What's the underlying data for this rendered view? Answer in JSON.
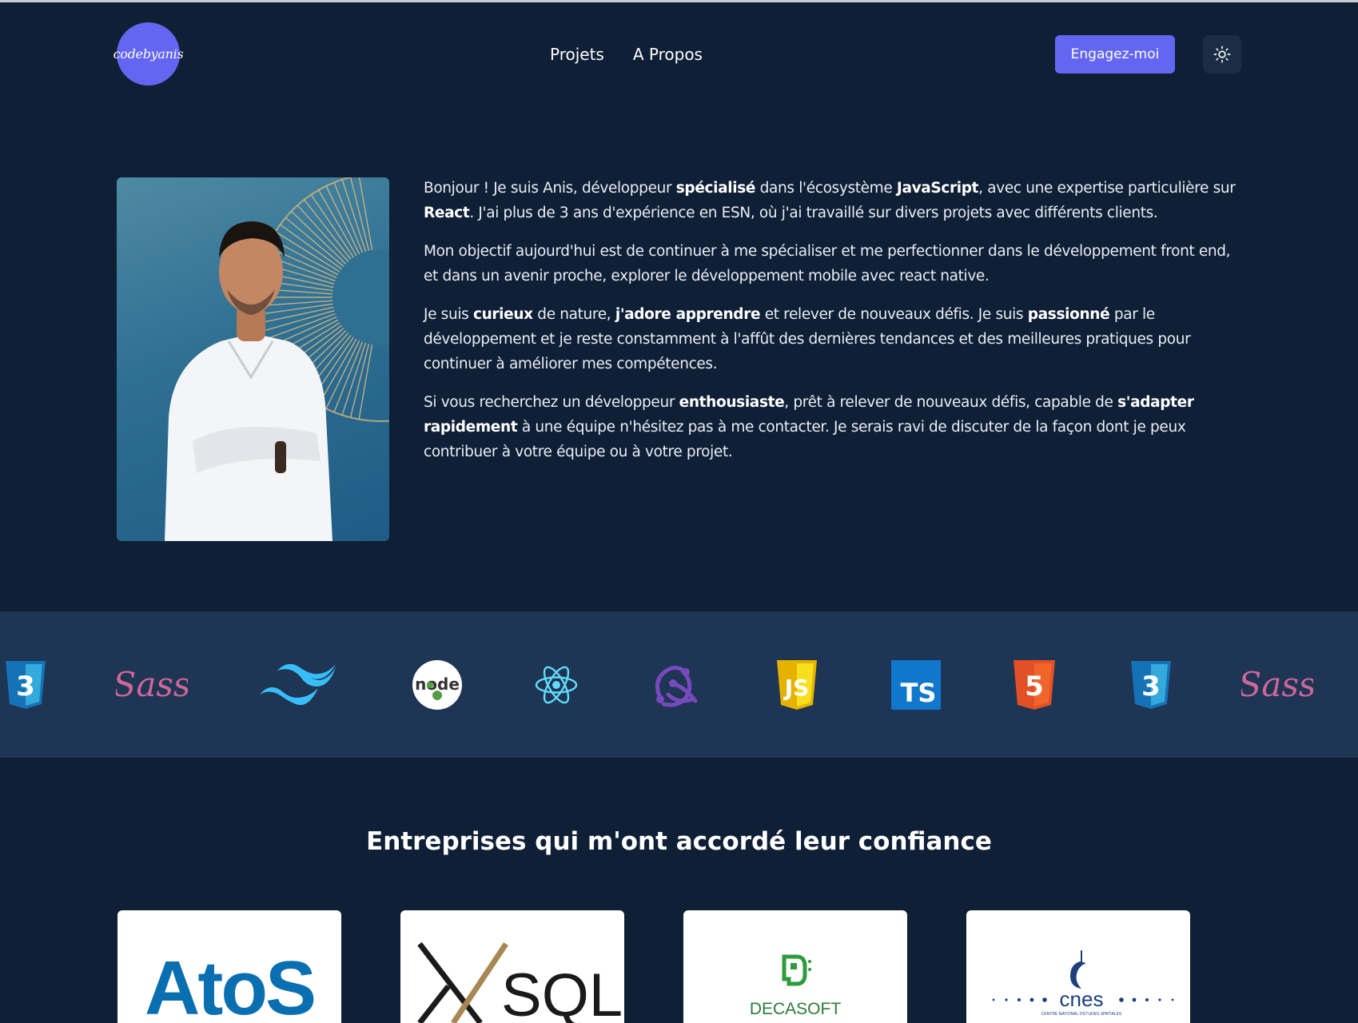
{
  "header": {
    "logo_text": "codebyanis",
    "nav": [
      {
        "label": "Projets"
      },
      {
        "label": "A Propos"
      }
    ],
    "hire_button": "Engagez-moi",
    "theme_toggle_icon": "sun-icon"
  },
  "about": {
    "paragraphs": [
      [
        {
          "t": "Bonjour ! Je suis Anis, développeur ",
          "b": false
        },
        {
          "t": "spécialisé",
          "b": true
        },
        {
          "t": " dans l'écosystème ",
          "b": false
        },
        {
          "t": "JavaScript",
          "b": true
        },
        {
          "t": ", avec une expertise particulière sur ",
          "b": false
        },
        {
          "t": "React",
          "b": true
        },
        {
          "t": ". J'ai plus de 3 ans d'expérience en ESN, où j'ai travaillé sur divers projets avec différents clients.",
          "b": false
        }
      ],
      [
        {
          "t": "Mon objectif aujourd'hui est de continuer à me spécialiser et me perfectionner dans le développement front end, et dans un avenir proche, explorer le développement mobile avec react native.",
          "b": false
        }
      ],
      [
        {
          "t": "Je suis ",
          "b": false
        },
        {
          "t": "curieux",
          "b": true
        },
        {
          "t": " de nature, ",
          "b": false
        },
        {
          "t": "j'adore apprendre",
          "b": true
        },
        {
          "t": " et relever de nouveaux défis. Je suis ",
          "b": false
        },
        {
          "t": "passionné",
          "b": true
        },
        {
          "t": " par le développement et je reste constamment à l'affût des dernières tendances et des meilleures pratiques pour continuer à améliorer mes compétences.",
          "b": false
        }
      ],
      [
        {
          "t": "Si vous recherchez un développeur ",
          "b": false
        },
        {
          "t": "enthousiaste",
          "b": true
        },
        {
          "t": ", prêt à relever de nouveaux défis, capable de ",
          "b": false
        },
        {
          "t": "s'adapter rapidement",
          "b": true
        },
        {
          "t": " à une équipe n'hésitez pas à me contacter. Je serais ravi de discuter de la façon dont je peux contribuer à votre équipe ou à votre projet.",
          "b": false
        }
      ]
    ]
  },
  "tech_icons": [
    {
      "name": "css3-icon",
      "label": "3"
    },
    {
      "name": "sass-icon",
      "label": "Sass"
    },
    {
      "name": "tailwind-icon"
    },
    {
      "name": "nodejs-icon",
      "label": "node"
    },
    {
      "name": "react-icon"
    },
    {
      "name": "redux-icon"
    },
    {
      "name": "javascript-icon",
      "label": "JS"
    },
    {
      "name": "typescript-icon",
      "label": "TS"
    },
    {
      "name": "html5-icon",
      "label": "5"
    },
    {
      "name": "css3-icon",
      "label": "3"
    },
    {
      "name": "sass-icon",
      "label": "Sass"
    }
  ],
  "companies": {
    "title": "Entreprises qui m'ont accordé leur confiance",
    "logos": [
      {
        "name": "Atos",
        "text": "AtoS"
      },
      {
        "name": "SQLI",
        "text": "SQLI"
      },
      {
        "name": "Decasoft",
        "text": "DECASOFT"
      },
      {
        "name": "CNES",
        "text": "cnes",
        "subtext": "CENTRE NATIONAL D'ÉTUDES SPATIALES"
      }
    ]
  },
  "colors": {
    "background": "#0f1f36",
    "band": "#1e3553",
    "accent": "#6366f1"
  }
}
